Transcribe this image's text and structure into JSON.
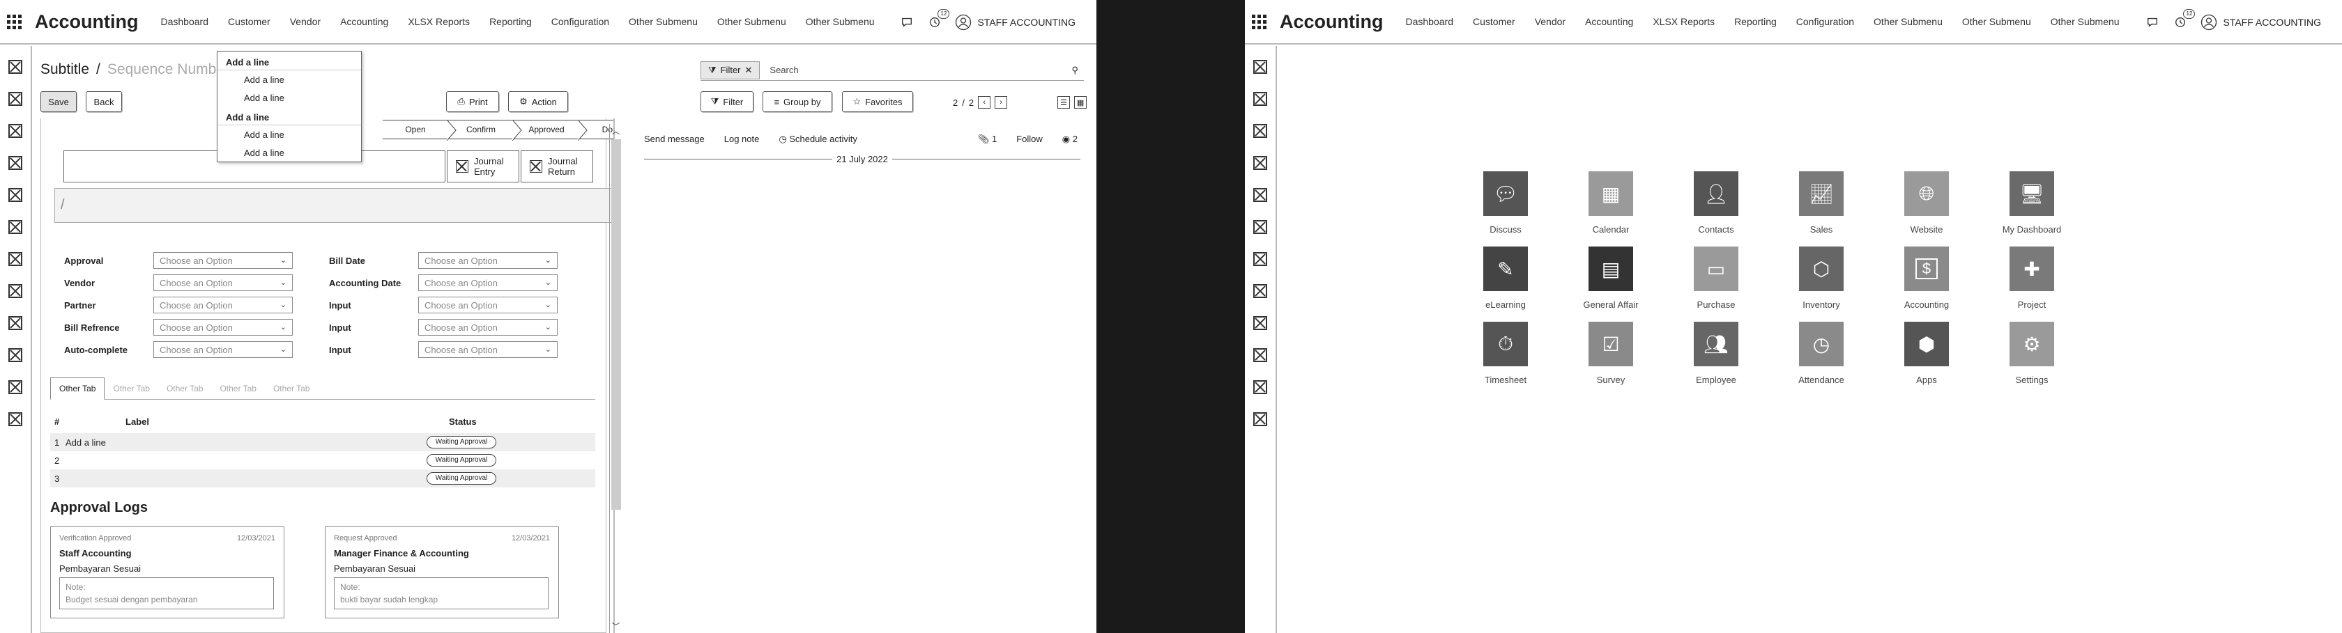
{
  "topbar": {
    "brand": "Accounting",
    "menu": [
      "Dashboard",
      "Customer",
      "Vendor",
      "Accounting",
      "XLSX Reports",
      "Reporting",
      "Configuration",
      "Other Submenu",
      "Other Submenu",
      "Other Submenu"
    ],
    "notification_count": "12",
    "user_name": "STAFF ACCOUNTING"
  },
  "form": {
    "title": "Subtitle",
    "separator": "/",
    "sequence_placeholder": "Sequence Number",
    "save_label": "Save",
    "back_label": "Back",
    "print_label": "Print",
    "action_label": "Action",
    "search_filter_chip": "Filter",
    "search_placeholder": "Search",
    "filter_label": "Filter",
    "groupby_label": "Group by",
    "favorites_label": "Favorites",
    "pager_current": "2",
    "pager_sep": "/",
    "pager_total": "2",
    "stages": [
      "Open",
      "Confirm",
      "Approved",
      "Done"
    ],
    "journal_entry": "Journal Entry",
    "journal_return": "Journal Return",
    "name_placeholder": "/",
    "fields_left": [
      {
        "label": "Approval",
        "value": "Choose an Option"
      },
      {
        "label": "Vendor",
        "value": "Choose an Option"
      },
      {
        "label": "Partner",
        "value": "Choose an Option"
      },
      {
        "label": "Bill Refrence",
        "value": "Choose an Option"
      },
      {
        "label": "Auto-complete",
        "value": "Choose an Option"
      }
    ],
    "fields_right": [
      {
        "label": "Bill Date",
        "value": "Choose an Option"
      },
      {
        "label": "Accounting Date",
        "value": "Choose an Option"
      },
      {
        "label": "Input",
        "value": "Choose an Option"
      },
      {
        "label": "Input",
        "value": "Choose an Option"
      },
      {
        "label": "Input",
        "value": "Choose an Option"
      }
    ],
    "tabs": [
      "Other Tab",
      "Other Tab",
      "Other Tab",
      "Other Tab",
      "Other Tab"
    ],
    "table": {
      "headers": [
        "#",
        "Label",
        "Status"
      ],
      "rows": [
        {
          "n": "1",
          "label": "Add a line",
          "status": "Waiting Approval"
        },
        {
          "n": "2",
          "label": "",
          "status": "Waiting Approval"
        },
        {
          "n": "3",
          "label": "",
          "status": "Waiting Approval"
        }
      ]
    },
    "approval_logs_title": "Approval Logs",
    "logs": [
      {
        "type": "Verification Approved",
        "date": "12/03/2021",
        "who": "Staff Accounting",
        "desc": "Pembayaran Sesuai",
        "note_label": "Note:",
        "note": "Budget sesuai dengan pembayaran"
      },
      {
        "type": "Request Approved",
        "date": "12/03/2021",
        "who": "Manager Finance & Accounting",
        "desc": "Pembayaran Sesuai",
        "note_label": "Note:",
        "note": "bukti bayar sudah lengkap"
      }
    ]
  },
  "dropdown": {
    "groups": [
      {
        "head": "Add a line",
        "items": [
          "Add a line",
          "Add a line"
        ]
      },
      {
        "head": "Add a line",
        "items": [
          "Add a line",
          "Add a line"
        ]
      }
    ]
  },
  "chatter": {
    "send_message": "Send message",
    "log_note": "Log note",
    "schedule_activity": "Schedule activity",
    "attachments": "1",
    "follow": "Follow",
    "followers": "2",
    "date_separator": "21 July 2022"
  },
  "apps": [
    {
      "name": "Discuss",
      "icon": "discuss-icon",
      "color": "#555555"
    },
    {
      "name": "Calendar",
      "icon": "calendar-icon",
      "color": "#9a9a9a"
    },
    {
      "name": "Contacts",
      "icon": "contacts-icon",
      "color": "#555555"
    },
    {
      "name": "Sales",
      "icon": "sales-icon",
      "color": "#7a7a7a"
    },
    {
      "name": "Website",
      "icon": "website-icon",
      "color": "#9a9a9a"
    },
    {
      "name": "My Dashboard",
      "icon": "dashboard-icon",
      "color": "#6a6a6a"
    },
    {
      "name": "eLearning",
      "icon": "elearning-icon",
      "color": "#444444"
    },
    {
      "name": "General Affair",
      "icon": "general-affair-icon",
      "color": "#333333"
    },
    {
      "name": "Purchase",
      "icon": "purchase-icon",
      "color": "#9a9a9a"
    },
    {
      "name": "Inventory",
      "icon": "inventory-icon",
      "color": "#666666"
    },
    {
      "name": "Accounting",
      "icon": "accounting-icon",
      "color": "#8a8a8a"
    },
    {
      "name": "Project",
      "icon": "project-icon",
      "color": "#7a7a7a"
    },
    {
      "name": "Timesheet",
      "icon": "timesheet-icon",
      "color": "#555555"
    },
    {
      "name": "Survey",
      "icon": "survey-icon",
      "color": "#8a8a8a"
    },
    {
      "name": "Employee",
      "icon": "employee-icon",
      "color": "#666666"
    },
    {
      "name": "Attendance",
      "icon": "attendance-icon",
      "color": "#8a8a8a"
    },
    {
      "name": "Apps",
      "icon": "apps-icon",
      "color": "#555555"
    },
    {
      "name": "Settings",
      "icon": "settings-icon",
      "color": "#9a9a9a"
    }
  ]
}
